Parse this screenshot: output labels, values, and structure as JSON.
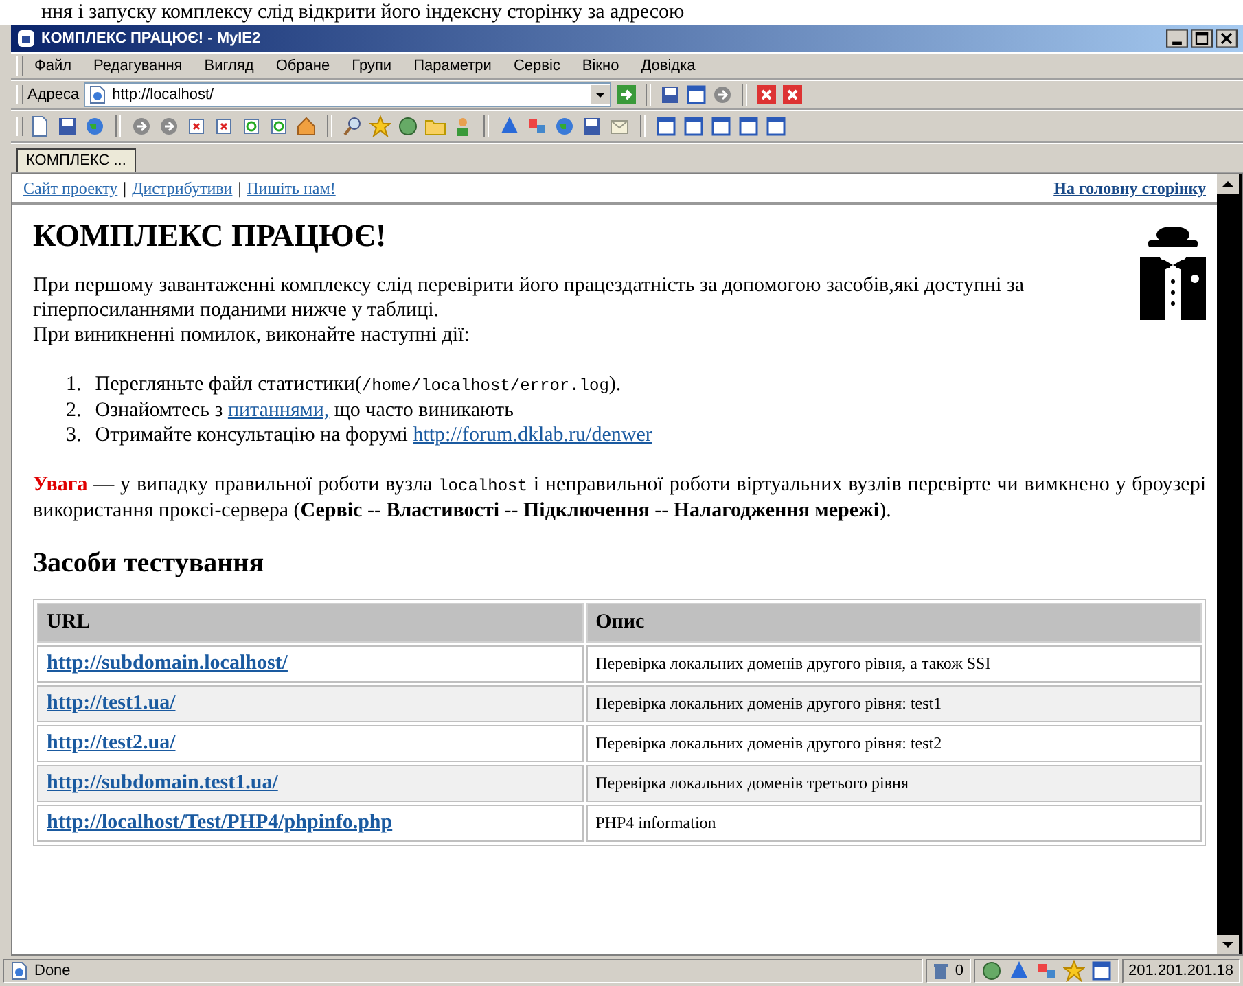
{
  "caption": "ння і запуску комплексу слід відкрити його індексну сторінку за адресою",
  "window": {
    "title": "КОМПЛЕКС ПРАЦЮЄ! - MyIE2"
  },
  "menu": [
    "Файл",
    "Редагування",
    "Вигляд",
    "Обране",
    "Групи",
    "Параметри",
    "Сервіс",
    "Вікно",
    "Довідка"
  ],
  "address": {
    "label": "Адреса",
    "value": "http://localhost/"
  },
  "tabs": [
    {
      "label": "КОМПЛЕКС ...",
      "selected": true
    }
  ],
  "page": {
    "nav_links": [
      "Сайт проекту",
      "Дистрибутиви",
      "Пишіть нам!"
    ],
    "nav_separators": [
      "|",
      "|"
    ],
    "home_link": "На головну сторінку",
    "heading": "КОМПЛЕКС ПРАЦЮЄ!",
    "intro": "При першому завантаженні комплексу слід перевірити його працездатність за допомогою засобів,які доступні за гіперпосиланнями поданими нижче у таблиці.",
    "intro_2": "При виникненні помилок, виконайте наступні дії:",
    "steps": [
      {
        "number": "1.",
        "segments": [
          {
            "kind": "text",
            "text": "Перегляньте файл статистики("
          },
          {
            "kind": "code",
            "text": "/home/localhost/error.log"
          },
          {
            "kind": "text",
            "text": ")."
          }
        ]
      },
      {
        "number": "2.",
        "segments": [
          {
            "kind": "text",
            "text": "Ознайомтесь з "
          },
          {
            "kind": "link",
            "text": "питаннями,"
          },
          {
            "kind": "text",
            "text": " що часто виникають"
          }
        ]
      },
      {
        "number": "3.",
        "segments": [
          {
            "kind": "text",
            "text": "Отримайте консультацію на форумі "
          },
          {
            "kind": "link",
            "text": "http://forum.dklab.ru/denwer"
          }
        ]
      }
    ],
    "warning": [
      {
        "kind": "alert",
        "text": "Увага"
      },
      {
        "kind": "text",
        "text": " — у випадку правильної роботи вузла "
      },
      {
        "kind": "code",
        "text": "localhost"
      },
      {
        "kind": "text",
        "text": " і неправильної роботи віртуальних вузлів перевірте чи вимкнено у броузері використання проксі-сервера ("
      },
      {
        "kind": "bold",
        "text": "Сервіс"
      },
      {
        "kind": "text",
        "text": " -- "
      },
      {
        "kind": "bold",
        "text": "Властивості"
      },
      {
        "kind": "text",
        "text": " -- "
      },
      {
        "kind": "bold",
        "text": "Підключення"
      },
      {
        "kind": "text",
        "text": " -- "
      },
      {
        "kind": "bold",
        "text": "Налагодження мережі"
      },
      {
        "kind": "text",
        "text": ")."
      }
    ],
    "section_heading": "Засоби тестування",
    "table": {
      "columns": [
        "URL",
        "Опис"
      ],
      "rows": [
        {
          "url": "http://subdomain.localhost/",
          "description": "Перевірка локальних доменів другого рівня, а також SSI"
        },
        {
          "url": "http://test1.ua/",
          "description": "Перевірка локальних доменів другого рівня: test1"
        },
        {
          "url": "http://test2.ua/",
          "description": "Перевірка локальних доменів другого рівня: test2"
        },
        {
          "url": "http://subdomain.test1.ua/",
          "description": "Перевірка локальних доменів третього рівня"
        },
        {
          "url": "http://localhost/Test/PHP4/phpinfo.php",
          "description": "PHP4 information"
        }
      ]
    }
  },
  "status_bar": {
    "text": "Done",
    "count": "0",
    "ip": "201.201.201.18"
  }
}
